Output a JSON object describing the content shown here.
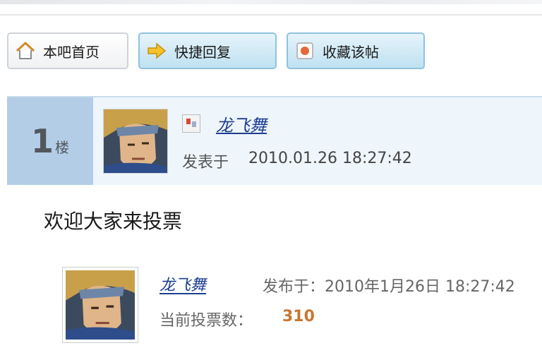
{
  "toolbar": {
    "home_label": "本吧首页",
    "reply_label": "快捷回复",
    "fav_label": "收藏该帖"
  },
  "post": {
    "floor_number": "1",
    "floor_suffix": "楼",
    "username": "龙飞舞",
    "posted_label": "发表于",
    "posted_time": "2010.01.26 18:27:42",
    "content": "欢迎大家来投票"
  },
  "vote": {
    "username": "龙飞舞",
    "published": "发布于：2010年1月26日 18:27:42",
    "count_label": "当前投票数：",
    "count": "310"
  },
  "colors": {
    "floor_bg": "#b3cde6",
    "header_bg": "#eef5fb",
    "link": "#1d3f8f",
    "vote_count": "#c7772e"
  },
  "icons": {
    "home": "house-icon",
    "reply": "arrow-right-icon",
    "fav": "bookmark-icon",
    "user": "user-badge-icon"
  }
}
